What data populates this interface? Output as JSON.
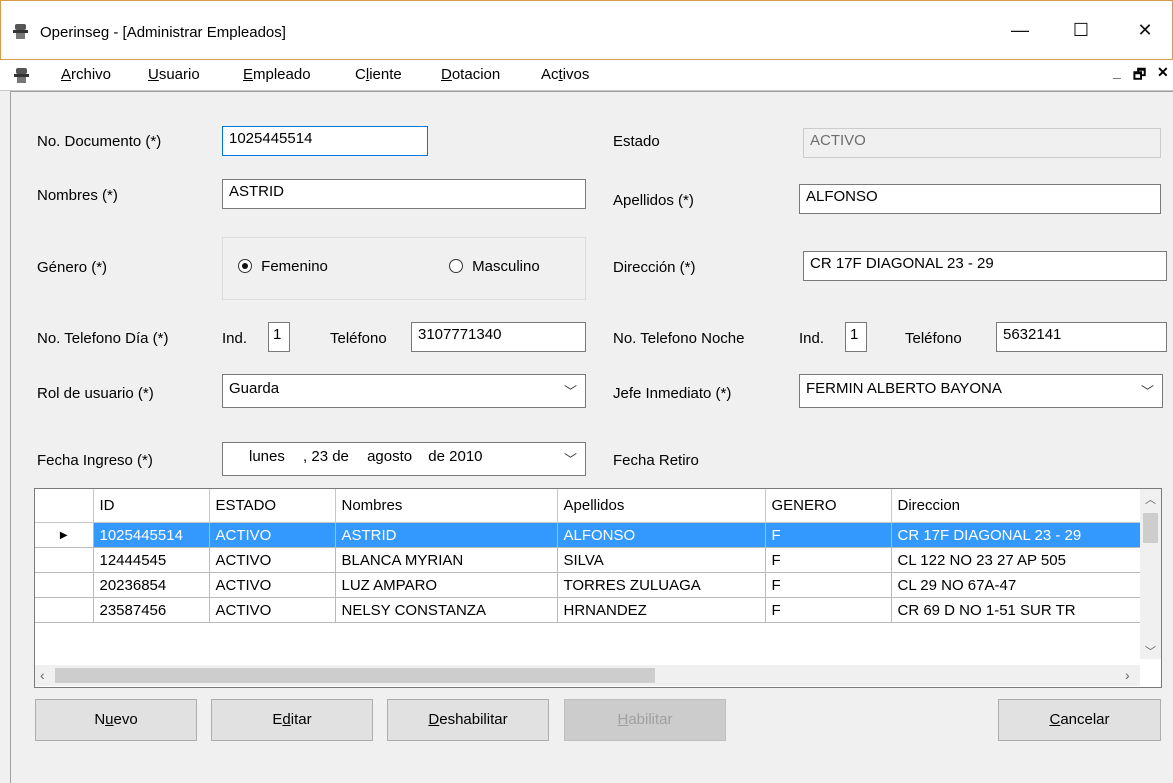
{
  "window": {
    "title": "Operinseg - [Administrar Empleados]",
    "minimize": "—",
    "maximize": "☐",
    "close": "✕"
  },
  "menu": {
    "items": [
      {
        "pre": "",
        "u": "A",
        "post": "rchivo"
      },
      {
        "pre": "",
        "u": "U",
        "post": "suario"
      },
      {
        "pre": "",
        "u": "E",
        "post": "mpleado"
      },
      {
        "pre": "C",
        "u": "l",
        "post": "iente"
      },
      {
        "pre": "",
        "u": "D",
        "post": "otacion"
      },
      {
        "pre": "Ac",
        "u": "t",
        "post": "ivos"
      }
    ],
    "mdi_min": "_",
    "mdi_restore": "🗗",
    "mdi_close": "✕"
  },
  "form": {
    "documento_label": "No. Documento (*)",
    "documento_value": "1025445514",
    "estado_label": "Estado",
    "estado_value": "ACTIVO",
    "nombres_label": "Nombres (*)",
    "nombres_value": "ASTRID",
    "apellidos_label": "Apellidos (*)",
    "apellidos_value": "ALFONSO",
    "genero_label": "Género (*)",
    "femenino_label": "Femenino",
    "masculino_label": "Masculino",
    "direccion_label": "Dirección (*)",
    "direccion_value": "CR 17F DIAGONAL 23 - 29",
    "tel_dia_label": "No. Telefono Día (*)",
    "ind_label": "Ind.",
    "ind_dia_value": "1",
    "telefono_label": "Teléfono",
    "tel_dia_value": "3107771340",
    "tel_noche_label": "No. Telefono Noche",
    "ind_noche_value": "1",
    "tel_noche_value": "5632141",
    "rol_label": "Rol de usuario (*)",
    "rol_value": "Guarda",
    "jefe_label": "Jefe Inmediato (*)",
    "jefe_value": "FERMIN ALBERTO BAYONA",
    "fecha_ingreso_label": "Fecha Ingreso (*)",
    "fecha_ingreso_day": "lunes",
    "fecha_ingreso_date": ", 23 de",
    "fecha_ingreso_month": "agosto",
    "fecha_ingreso_year": "de 2010",
    "fecha_retiro_label": "Fecha Retiro"
  },
  "grid": {
    "columns": [
      "ID",
      "ESTADO",
      "Nombres",
      "Apellidos",
      "GENERO",
      "Direccion"
    ],
    "rows": [
      [
        "1025445514",
        "ACTIVO",
        "ASTRID",
        "ALFONSO",
        "F",
        "CR 17F DIAGONAL 23 - 29"
      ],
      [
        "12444545",
        "ACTIVO",
        "BLANCA MYRIAN",
        "SILVA",
        "F",
        "CL 122  NO 23 27  AP 505"
      ],
      [
        "20236854",
        "ACTIVO",
        "LUZ AMPARO",
        "TORRES ZULUAGA",
        "F",
        "CL 29   NO 67A-47"
      ],
      [
        "23587456",
        "ACTIVO",
        "NELSY CONSTANZA",
        "HRNANDEZ",
        "F",
        "CR 69 D   NO 1-51 SUR TR"
      ]
    ],
    "selected_marker": "▶"
  },
  "buttons": {
    "nuevo": {
      "pre": "N",
      "u": "u",
      "post": "evo"
    },
    "editar": {
      "pre": "E",
      "u": "d",
      "post": "itar"
    },
    "deshabilitar": {
      "pre": "",
      "u": "D",
      "post": "eshabilitar"
    },
    "habilitar": {
      "pre": "",
      "u": "H",
      "post": "abilitar"
    },
    "cancelar": {
      "pre": "",
      "u": "C",
      "post": "ancelar"
    }
  }
}
